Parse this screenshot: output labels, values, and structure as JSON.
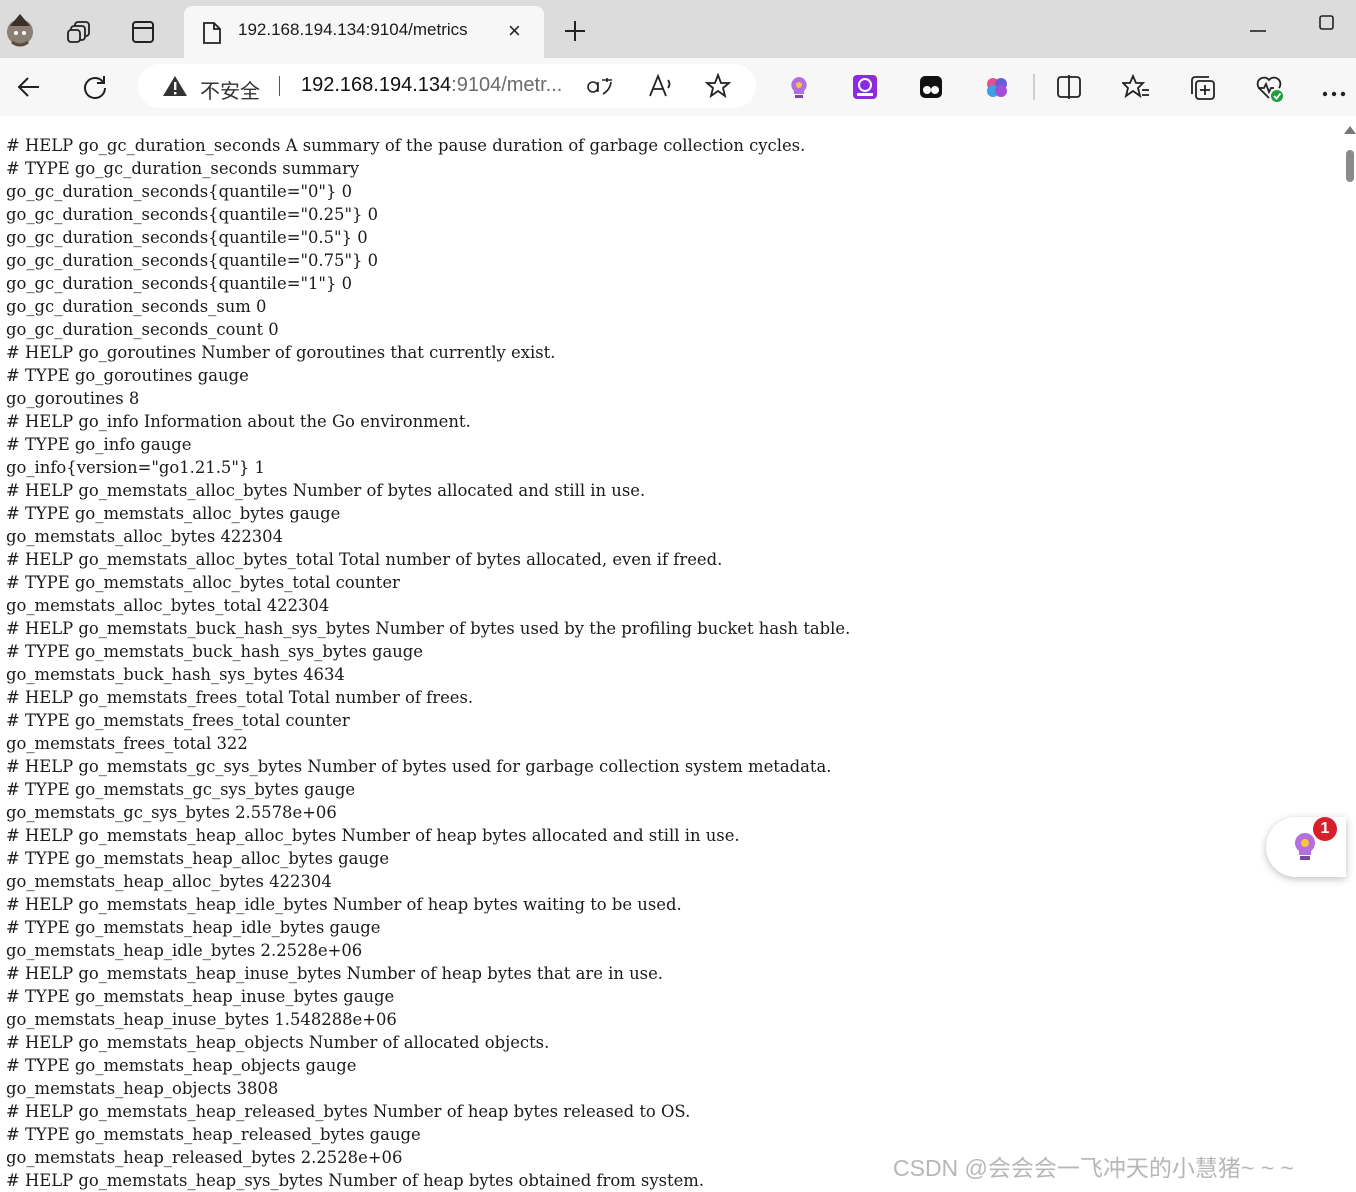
{
  "browser": {
    "tab": {
      "title": "192.168.194.134:9104/metrics",
      "close_label": "×"
    },
    "address_bar": {
      "security_label": "不安全",
      "url_host": "192.168.194.134",
      "url_rest": ":9104/metr..."
    },
    "toolbar_icons": [
      "back-icon",
      "refresh-icon",
      "warning-icon",
      "read-aloud-icon",
      "translate-icon",
      "favorite-star-icon",
      "extension-bulb-icon",
      "extension-chatgpt-icon",
      "extension-game-icon",
      "extension-brain-icon",
      "split-screen-icon",
      "favorites-icon",
      "collections-icon",
      "performance-icon",
      "more-icon"
    ]
  },
  "metrics_lines": [
    "# HELP go_gc_duration_seconds A summary of the pause duration of garbage collection cycles.",
    "# TYPE go_gc_duration_seconds summary",
    "go_gc_duration_seconds{quantile=\"0\"} 0",
    "go_gc_duration_seconds{quantile=\"0.25\"} 0",
    "go_gc_duration_seconds{quantile=\"0.5\"} 0",
    "go_gc_duration_seconds{quantile=\"0.75\"} 0",
    "go_gc_duration_seconds{quantile=\"1\"} 0",
    "go_gc_duration_seconds_sum 0",
    "go_gc_duration_seconds_count 0",
    "# HELP go_goroutines Number of goroutines that currently exist.",
    "# TYPE go_goroutines gauge",
    "go_goroutines 8",
    "# HELP go_info Information about the Go environment.",
    "# TYPE go_info gauge",
    "go_info{version=\"go1.21.5\"} 1",
    "# HELP go_memstats_alloc_bytes Number of bytes allocated and still in use.",
    "# TYPE go_memstats_alloc_bytes gauge",
    "go_memstats_alloc_bytes 422304",
    "# HELP go_memstats_alloc_bytes_total Total number of bytes allocated, even if freed.",
    "# TYPE go_memstats_alloc_bytes_total counter",
    "go_memstats_alloc_bytes_total 422304",
    "# HELP go_memstats_buck_hash_sys_bytes Number of bytes used by the profiling bucket hash table.",
    "# TYPE go_memstats_buck_hash_sys_bytes gauge",
    "go_memstats_buck_hash_sys_bytes 4634",
    "# HELP go_memstats_frees_total Total number of frees.",
    "# TYPE go_memstats_frees_total counter",
    "go_memstats_frees_total 322",
    "# HELP go_memstats_gc_sys_bytes Number of bytes used for garbage collection system metadata.",
    "# TYPE go_memstats_gc_sys_bytes gauge",
    "go_memstats_gc_sys_bytes 2.5578e+06",
    "# HELP go_memstats_heap_alloc_bytes Number of heap bytes allocated and still in use.",
    "# TYPE go_memstats_heap_alloc_bytes gauge",
    "go_memstats_heap_alloc_bytes 422304",
    "# HELP go_memstats_heap_idle_bytes Number of heap bytes waiting to be used.",
    "# TYPE go_memstats_heap_idle_bytes gauge",
    "go_memstats_heap_idle_bytes 2.2528e+06",
    "# HELP go_memstats_heap_inuse_bytes Number of heap bytes that are in use.",
    "# TYPE go_memstats_heap_inuse_bytes gauge",
    "go_memstats_heap_inuse_bytes 1.548288e+06",
    "# HELP go_memstats_heap_objects Number of allocated objects.",
    "# TYPE go_memstats_heap_objects gauge",
    "go_memstats_heap_objects 3808",
    "# HELP go_memstats_heap_released_bytes Number of heap bytes released to OS.",
    "# TYPE go_memstats_heap_released_bytes gauge",
    "go_memstats_heap_released_bytes 2.2528e+06",
    "# HELP go_memstats_heap_sys_bytes Number of heap bytes obtained from system."
  ],
  "floating_button": {
    "badge_count": "1"
  },
  "watermark": "CSDN @会会会一飞冲天的小慧猪~ ~ ~"
}
